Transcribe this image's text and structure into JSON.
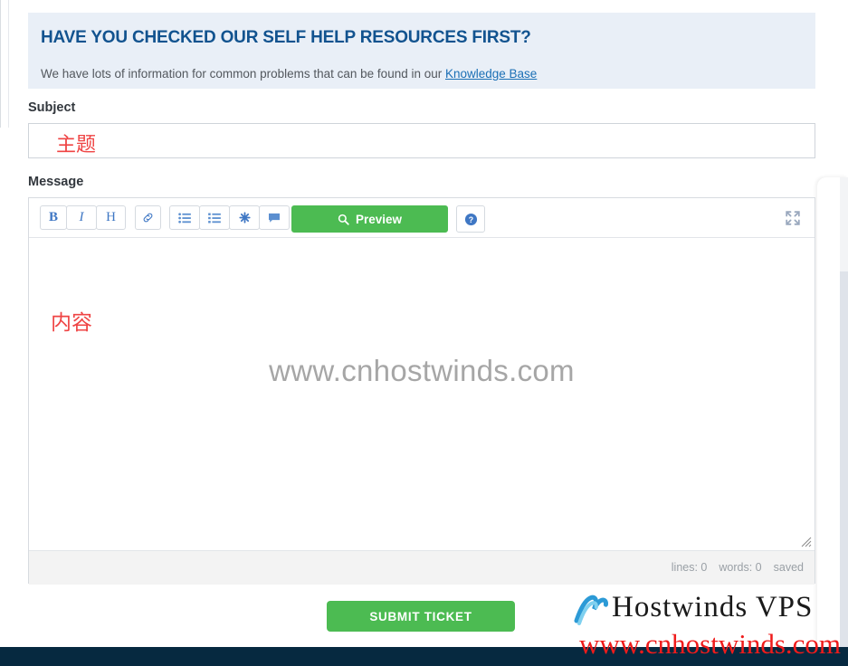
{
  "banner": {
    "title": "HAVE YOU CHECKED OUR SELF HELP RESOURCES FIRST?",
    "text_before_link": "We have lots of information for common problems that can be found in our ",
    "link_label": "Knowledge Base"
  },
  "form": {
    "subject_label": "Subject",
    "subject_annotation": "主题",
    "message_label": "Message",
    "message_annotation": "内容",
    "message_watermark": "www.cnhostwinds.com"
  },
  "toolbar": {
    "bold_label": "B",
    "italic_label": "I",
    "heading_label": "H",
    "link_icon": "link-icon",
    "unordered_list_icon": "unordered-list-icon",
    "ordered_list_icon": "ordered-list-icon",
    "asterisk_icon": "asterisk-icon",
    "quote_icon": "speech-bubble-icon",
    "preview_label": "Preview",
    "preview_icon": "search-icon",
    "help_icon": "question-circle-icon",
    "expand_icon": "fullscreen-expand-icon"
  },
  "status": {
    "lines": "lines: 0",
    "words": "words: 0",
    "saved": "saved"
  },
  "actions": {
    "submit_label": "SUBMIT TICKET"
  },
  "watermark": {
    "brand": "Hostwinds VPS",
    "url": "www.cnhostwinds.com",
    "logo_icon": "hostwinds-wave-logo"
  },
  "colors": {
    "banner_bg": "#e9eff7",
    "banner_title": "#12538f",
    "link": "#1a6fb5",
    "accent_green": "#4cbb52",
    "toolbar_icon_blue": "#3f77c4",
    "annotation_red": "#ef4444",
    "footer_navy": "#062940",
    "watermark_grey": "#a6a6a6",
    "watermark_red": "#ef1b1b"
  }
}
